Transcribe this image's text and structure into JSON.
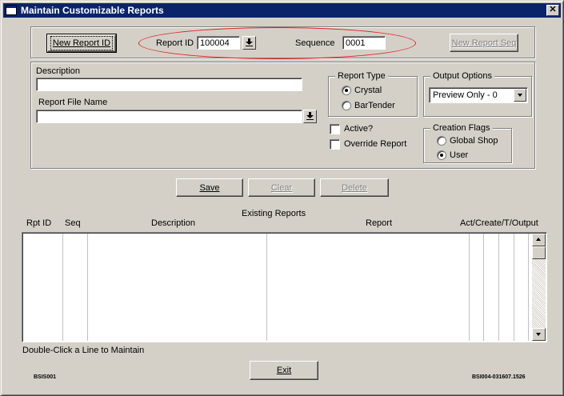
{
  "window": {
    "title": "Maintain Customizable Reports",
    "close_glyph": "✕"
  },
  "top": {
    "new_report_id_label": "New Report ID",
    "report_id_label": "Report ID",
    "report_id_value": "100004",
    "sequence_label": "Sequence",
    "sequence_value": "0001",
    "new_report_seq_label": "New Report Seq"
  },
  "details": {
    "description_label": "Description",
    "description_value": "",
    "report_file_name_label": "Report File Name",
    "report_file_name_value": "",
    "report_type": {
      "title": "Report Type",
      "options": [
        "Crystal",
        "BarTender"
      ],
      "selected": "Crystal"
    },
    "output_options": {
      "title": "Output Options",
      "selected": "Preview Only - 0"
    },
    "active_label": "Active?",
    "override_label": "Override Report",
    "creation_flags": {
      "title": "Creation Flags",
      "options": [
        "Global Shop",
        "User"
      ],
      "selected": "User"
    }
  },
  "actions": {
    "save_label": "Save",
    "clear_label": "Clear",
    "delete_label": "Delete"
  },
  "grid": {
    "title": "Existing Reports",
    "columns": [
      "Rpt ID",
      "Seq",
      "Description",
      "Report",
      "Act/Create/T/Output"
    ],
    "rows": []
  },
  "footer": {
    "hint": "Double-Click a Line to Maintain",
    "exit_label": "Exit",
    "left_code": "BSIS001",
    "right_code": "BSI004-031607.1526"
  },
  "colors": {
    "titlebar": "#0a246a",
    "face": "#d4d0c8",
    "annotation": "#e02020"
  },
  "icons": {
    "title": "window-icon",
    "close": "close-icon",
    "lookup": "download-arrow-icon",
    "dropdown": "chevron-down-icon",
    "scroll_up": "scroll-up-arrow-icon",
    "scroll_down": "scroll-down-arrow-icon"
  }
}
